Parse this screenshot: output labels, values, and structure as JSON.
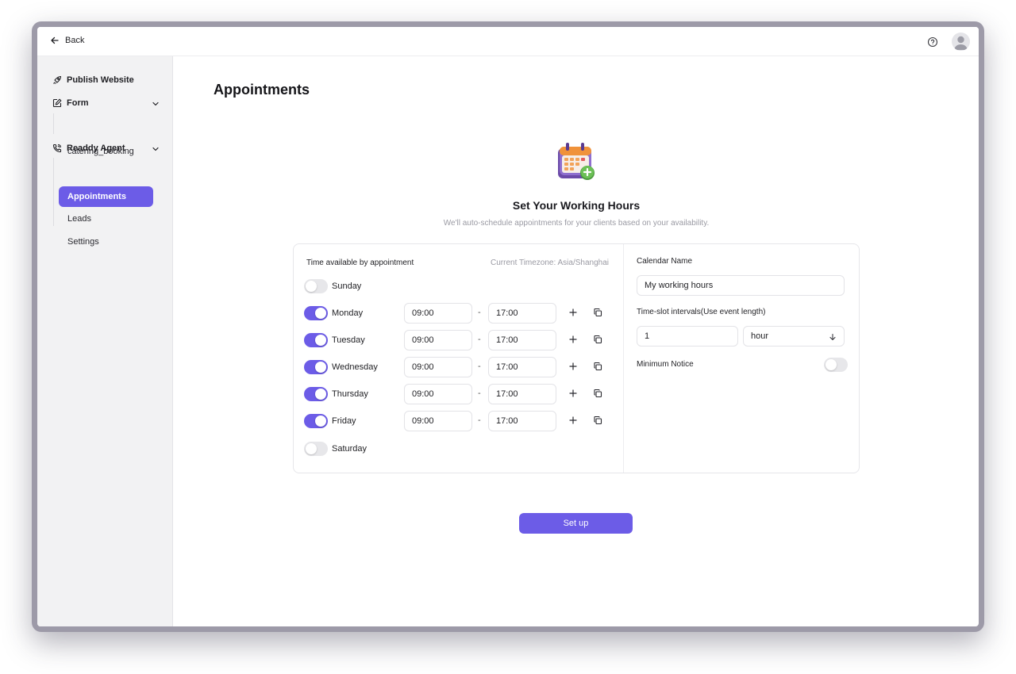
{
  "topbar": {
    "back_label": "Back",
    "help_icon": "help-circle-icon",
    "avatar_icon": "user-avatar-icon"
  },
  "sidebar": {
    "publish_label": "Publish Website",
    "form_label": "Form",
    "form_items": [
      {
        "label": "catering_booking"
      }
    ],
    "agent_label": "Readdy Agent",
    "agent_items": [
      {
        "label": "Appointments",
        "active": true
      },
      {
        "label": "Leads",
        "active": false
      },
      {
        "label": "Settings",
        "active": false
      }
    ]
  },
  "main": {
    "title": "Appointments",
    "hero_title": "Set Your Working Hours",
    "hero_subtitle": "We'll auto-schedule appointments for your clients based on your availability.",
    "availability": {
      "heading": "Time available by appointment",
      "timezone": "Current Timezone: Asia/Shanghai",
      "separator": "-",
      "days": [
        {
          "name": "Sunday",
          "enabled": false,
          "start": "",
          "end": ""
        },
        {
          "name": "Monday",
          "enabled": true,
          "start": "09:00",
          "end": "17:00"
        },
        {
          "name": "Tuesday",
          "enabled": true,
          "start": "09:00",
          "end": "17:00"
        },
        {
          "name": "Wednesday",
          "enabled": true,
          "start": "09:00",
          "end": "17:00"
        },
        {
          "name": "Thursday",
          "enabled": true,
          "start": "09:00",
          "end": "17:00"
        },
        {
          "name": "Friday",
          "enabled": true,
          "start": "09:00",
          "end": "17:00"
        },
        {
          "name": "Saturday",
          "enabled": false,
          "start": "",
          "end": ""
        }
      ]
    },
    "calendar": {
      "name_label": "Calendar Name",
      "name_value": "My working hours",
      "interval_label": "Time-slot intervals(Use event length)",
      "interval_value": "1",
      "interval_unit": "hour",
      "min_notice_label": "Minimum Notice",
      "min_notice_enabled": false
    },
    "setup_button": "Set up"
  },
  "colors": {
    "accent": "#6c5ce7",
    "sidebar_bg": "#f2f2f3",
    "muted_text": "#9a9aa3"
  }
}
